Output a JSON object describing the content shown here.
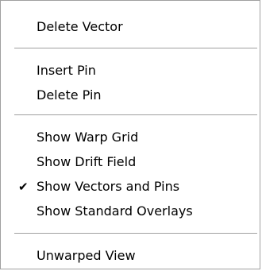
{
  "menu": {
    "items": [
      {
        "label": "Delete Vector"
      },
      {
        "label": "Insert Pin"
      },
      {
        "label": "Delete Pin"
      },
      {
        "label": "Show Warp Grid"
      },
      {
        "label": "Show Drift Field"
      },
      {
        "label": "Show Vectors and Pins",
        "checked": true,
        "check_glyph": "✔"
      },
      {
        "label": "Show Standard Overlays"
      },
      {
        "label": "Unwarped View"
      }
    ]
  }
}
